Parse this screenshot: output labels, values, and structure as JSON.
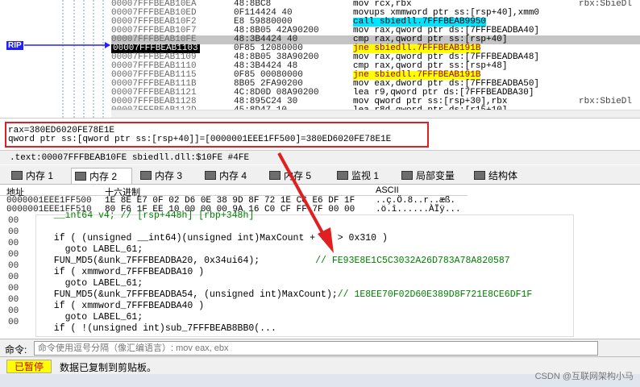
{
  "disassembly": {
    "rip_label": "RIP",
    "rows": [
      {
        "addr": "00007FFFBEAB10EA",
        "bytes": "48:8BC8",
        "instr": "mov rcx,rbx",
        "cmt": "rbx:SbieDl"
      },
      {
        "addr": "00007FFFBEAB10ED",
        "bytes": "0F114424 40",
        "instr": "movups xmmword ptr ss:[rsp+40],xmm0",
        "cmt": ""
      },
      {
        "addr": "00007FFFBEAB10F2",
        "bytes": "E8 59880000",
        "instr": "call sbiedll.7FFFBEAB9950",
        "cmt": "",
        "kind": "call"
      },
      {
        "addr": "00007FFFBEAB10F7",
        "bytes": "48:8B05 42A90200",
        "instr": "mov rax,qword ptr ds:[7FFFBEADBA40]",
        "cmt": ""
      },
      {
        "addr": "00007FFFBEAB10FE",
        "bytes": "48:3B4424 40",
        "instr": "cmp rax,qword ptr ss:[rsp+40]",
        "cmt": "",
        "cur": true
      },
      {
        "addr": "00007FFFBEAB1103",
        "bytes": "0F85 12080000",
        "instr": "jne sbiedll.7FFFBEAB191B",
        "cmt": "",
        "kind": "jump",
        "hl": true
      },
      {
        "addr": "00007FFFBEAB1109",
        "bytes": "48:8B05 38A90200",
        "instr": "mov rax,qword ptr ds:[7FFFBEADBA48]",
        "cmt": ""
      },
      {
        "addr": "00007FFFBEAB1110",
        "bytes": "48:3B4424 48",
        "instr": "cmp rax,qword ptr ss:[rsp+48]",
        "cmt": ""
      },
      {
        "addr": "00007FFFBEAB1115",
        "bytes": "0F85 00080000",
        "instr": "jne sbiedll.7FFFBEAB191B",
        "cmt": "",
        "kind": "jump"
      },
      {
        "addr": "00007FFFBEAB111B",
        "bytes": "8B05 2FA90200",
        "instr": "mov eax,dword ptr ds:[7FFFBEADBA50]",
        "cmt": ""
      },
      {
        "addr": "00007FFFBEAB1121",
        "bytes": "4C:8D0D 08A90200",
        "instr": "lea r9,qword ptr ds:[7FFFBEADBA30]",
        "cmt": ""
      },
      {
        "addr": "00007FFFBEAB1128",
        "bytes": "48:895C24 30",
        "instr": "mov qword ptr ss:[rsp+30],rbx",
        "cmt": "rbx:SbieDl"
      },
      {
        "addr": "00007FFFBEAB112D",
        "bytes": "45:8D47 10",
        "instr": "lea r8d,qword ptr ds:[r15+10]",
        "cmt": ""
      }
    ]
  },
  "info": {
    "line1": "rax=380ED6020FE78E1E",
    "line2": "qword ptr ss:[qword ptr ss:[rsp+40]]=[0000001EEE1FF500]=380ED6020FE78E1E"
  },
  "location": ".text:00007FFFBEAB10FE sbiedll.dll:$10FE #4FE",
  "tabs": [
    {
      "label": "内存 1",
      "active": false
    },
    {
      "label": "内存 2",
      "active": true
    },
    {
      "label": "内存 3",
      "active": false
    },
    {
      "label": "内存 4",
      "active": false
    },
    {
      "label": "内存 5",
      "active": false
    },
    {
      "label": "监视 1",
      "active": false
    },
    {
      "label": "局部变量",
      "active": false
    },
    {
      "label": "结构体",
      "active": false
    }
  ],
  "dump": {
    "col_addr": "地址",
    "col_hex": "十六进制",
    "col_ascii": "ASCII",
    "rows": [
      {
        "addr": "0000001EEE1FF500",
        "hex": "1E 8E E7 0F 02 D6 0E 38 9D 8F 72 1E CC E6 DF 1F",
        "ascii": "..ç.Ö.8..r..æß."
      },
      {
        "addr": "0000001EEE1FF510",
        "hex": "80 F6 1F EE 10 00 00 00 9A 16 C0 CF FF 7F 00 00",
        "ascii": ".ö.î......ÀÏÿ..."
      }
    ]
  },
  "code": {
    "lines": [
      {
        "text": "  __int64 v4; // [rsp+448h] [rbp+348h]",
        "cls": "cmtg"
      },
      {
        "text": "",
        "cls": ""
      },
      {
        "text": "  if ( (unsigned __int64)(unsigned int)MaxCount + 68 > 0x310 )",
        "cls": ""
      },
      {
        "text": "    goto LABEL_61;",
        "cls": ""
      },
      {
        "text": "  FUN_MD5(&unk_7FFFBEADBA20, 0x34ui64);          // FE93E8E1C5C3032A26D783A78A820587",
        "cls": "mix"
      },
      {
        "text": "  if ( xmmword_7FFFBEADBA10 )",
        "cls": ""
      },
      {
        "text": "    goto LABEL_61;",
        "cls": ""
      },
      {
        "text": "  FUN_MD5(&unk_7FFFBEADBA54, (unsigned int)MaxCount);// 1E8EE70F02D60E389D8F721E8CE6DF1F",
        "cls": "mix"
      },
      {
        "text": "  if ( xmmword_7FFFBEADBA40 )",
        "cls": ""
      },
      {
        "text": "    goto LABEL_61;",
        "cls": ""
      },
      {
        "text": "  if ( !(unsigned int)sub_7FFFBEAB8BB0(...",
        "cls": ""
      }
    ],
    "gutter": [
      "00",
      "00",
      "00",
      "00",
      "00",
      "00",
      "00",
      "00",
      "00",
      "00"
    ]
  },
  "command": {
    "label": "命令:",
    "placeholder": "命令使用逗号分隔（像汇编语言）: mov eax, ebx"
  },
  "status": {
    "paused": "已暂停",
    "message": "数据已复制到剪贴板。"
  },
  "watermark": "CSDN @互联网架构小马",
  "colors": {
    "accent_red": "#e02020",
    "call_bg": "#00e5ff",
    "jump_bg": "#ffff00"
  }
}
